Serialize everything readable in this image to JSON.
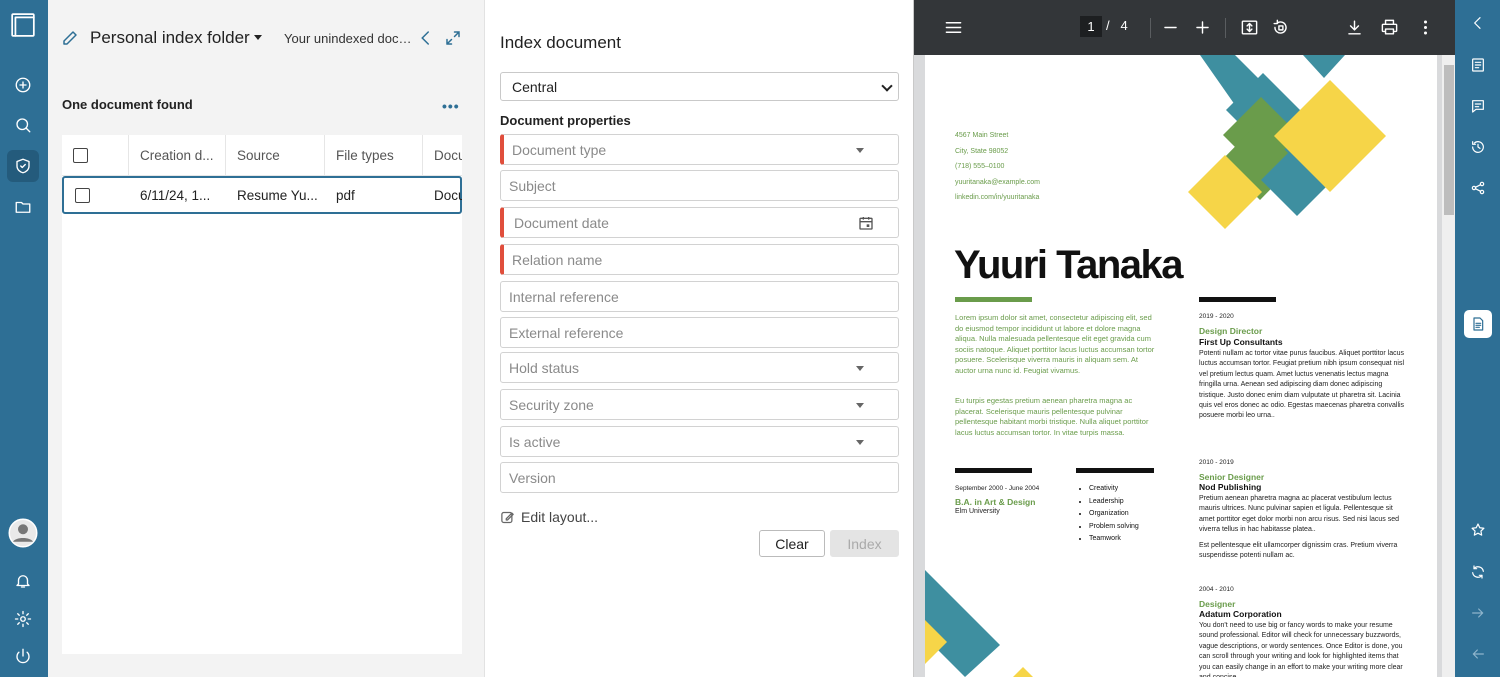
{
  "folder": {
    "title": "Personal index folder",
    "unindexed_link": "Your unindexed documents",
    "result_count": "One document found",
    "more_label": "•••",
    "columns": [
      "Creation d...",
      "Source",
      "File types",
      "Docu"
    ],
    "rows": [
      {
        "creation_date": "6/11/24, 1...",
        "source": "Resume Yu...",
        "file_type": "pdf",
        "doc": "Docu"
      }
    ]
  },
  "index": {
    "title": "Index document",
    "location_value": "Central",
    "section_label": "Document properties",
    "fields": {
      "document_type": "Document type",
      "subject": "Subject",
      "document_date": "Document date",
      "relation_name": "Relation name",
      "internal_reference": "Internal reference",
      "external_reference": "External reference",
      "hold_status": "Hold status",
      "security_zone": "Security zone",
      "is_active": "Is active",
      "version": "Version"
    },
    "edit_layout": "Edit layout...",
    "clear_label": "Clear",
    "index_label": "Index"
  },
  "pdf": {
    "page_current": "1",
    "page_sep": "/",
    "page_total": "4",
    "resume": {
      "contact": [
        "4567 Main Street",
        "City, State 98052",
        "(718) 555–0100",
        "yuuritanaka@example.com",
        "linkedin.com/in/yuuritanaka"
      ],
      "name": "Yuuri Tanaka",
      "intro_1": "Lorem ipsum dolor sit amet, consectetur adipiscing elit, sed do eiusmod tempor incididunt ut labore et dolore magna aliqua. Nulla malesuada pellentesque elit eget gravida cum sociis natoque. Aliquet porttitor lacus luctus accumsan tortor posuere. Scelerisque viverra mauris in aliquam sem. At auctor urna nunc id. Feugiat vivamus.",
      "intro_2": "Eu turpis egestas pretium aenean pharetra magna ac placerat. Scelerisque mauris pellentesque pulvinar pellentesque habitant morbi tristique. Nulla aliquet porttitor lacus luctus accumsan tortor. In vitae turpis massa.",
      "edu_date": "September 2000 - June 2004",
      "edu_degree": "B.A. in Art & Design",
      "edu_school": "Elm University",
      "skills": [
        "Creativity",
        "Leadership",
        "Organization",
        "Problem solving",
        "Teamwork"
      ],
      "jobs": [
        {
          "date": "2019 - 2020",
          "title": "Design Director",
          "company": "First Up Consultants",
          "desc": "Potenti nullam ac tortor vitae purus faucibus. Aliquet porttitor lacus luctus accumsan tortor. Feugiat pretium nibh ipsum consequat nisl vel pretium lectus quam. Amet luctus venenatis lectus magna fringilla urna. Aenean sed adipiscing diam donec adipiscing tristique. Justo donec enim diam vulputate ut pharetra sit. Lacinia quis vel eros donec ac odio. Egestas maecenas pharetra convallis posuere morbi leo urna.."
        },
        {
          "date": "2010 - 2019",
          "title": "Senior Designer",
          "company": "Nod Publishing",
          "desc": "Pretium aenean pharetra magna ac placerat vestibulum lectus mauris ultrices. Nunc pulvinar sapien et ligula. Pellentesque sit amet porttitor eget dolor morbi non arcu risus. Sed nisi lacus sed viverra tellus in hac habitasse platea..",
          "desc2": "Est pellentesque elit ullamcorper dignissim cras. Pretium viverra suspendisse potenti nullam ac."
        },
        {
          "date": "2004 - 2010",
          "title": "Designer",
          "company": "Adatum Corporation",
          "desc": "You don't need to use big or fancy words to make your resume sound professional. Editor will check for unnecessary buzzwords, vague descriptions, or wordy sentences. Once Editor is done, you can scroll through your writing and look for highlighted items that you can easily change in an effort to make your writing more clear and concise."
        }
      ]
    }
  },
  "colors": {
    "brand": "#2e6f95",
    "required": "#e04e3c",
    "resume_green": "#6a9c4b",
    "resume_yellow": "#f6d548",
    "resume_teal": "#3e8fa0"
  }
}
